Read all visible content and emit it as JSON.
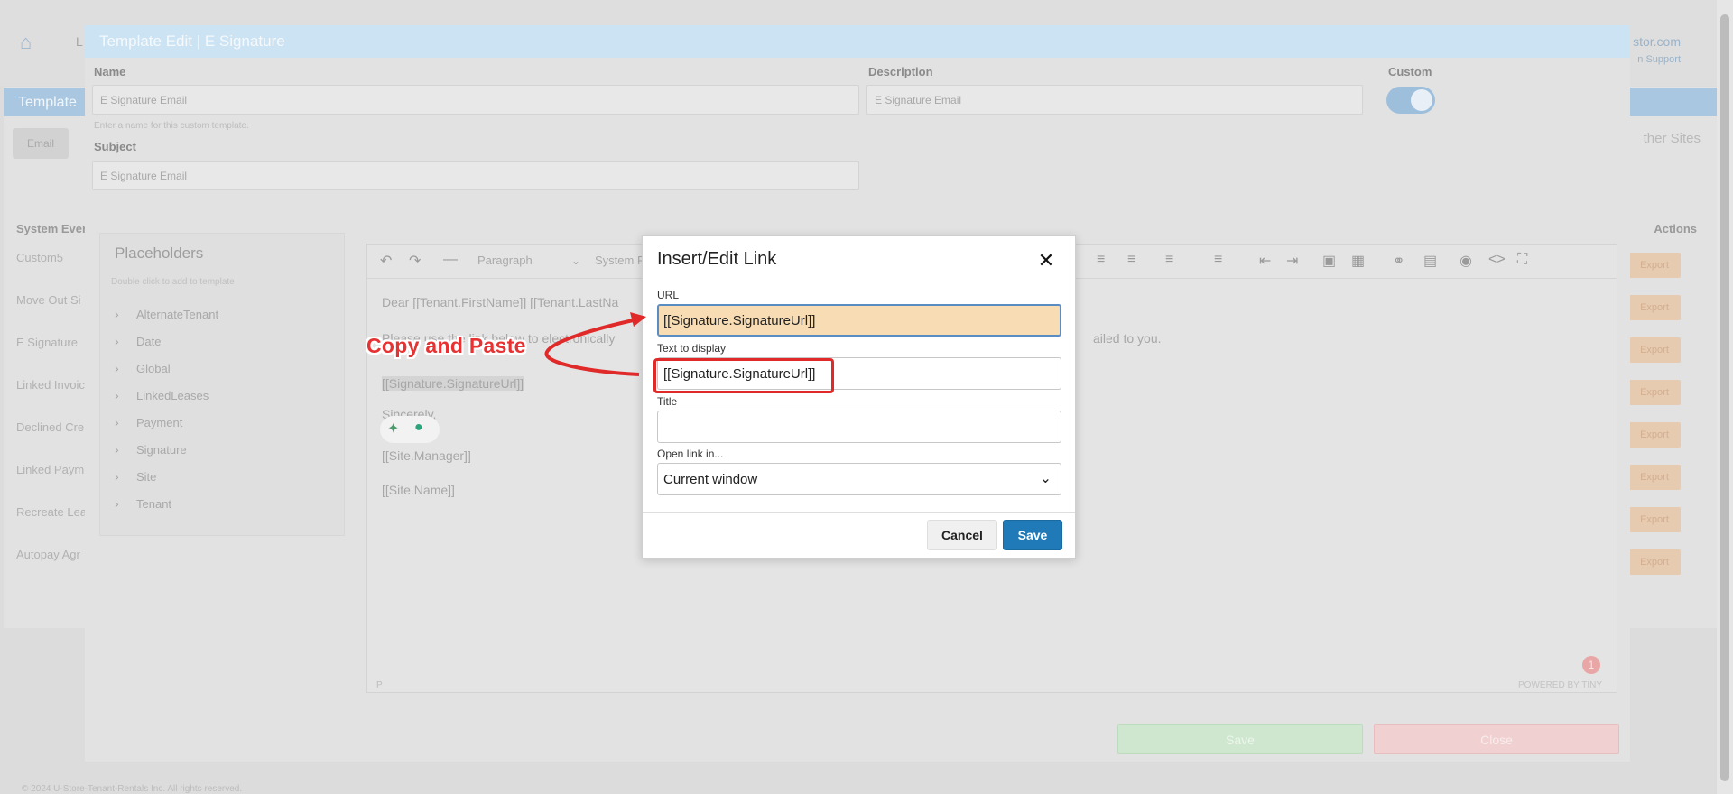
{
  "background": {
    "header_letter": "L",
    "user_line": "stor.com",
    "user_sub": "n Support",
    "page_header": "Template",
    "tab": "Email",
    "other_sites": "ther Sites",
    "system_events_label": "System Ever",
    "actions_label": "Actions",
    "rows": [
      "Custom5",
      "Move Out Si",
      "E Signature",
      "Linked Invoic",
      "Declined Cre",
      "Linked Paym",
      "Recreate Lea",
      "Autopay Agr"
    ],
    "export_label": "Export"
  },
  "template_modal": {
    "title": "Template Edit | E Signature",
    "name_label": "Name",
    "name_value": "E Signature Email",
    "name_hint": "Enter a name for this custom template.",
    "description_label": "Description",
    "description_value": "E Signature Email",
    "custom_label": "Custom",
    "subject_label": "Subject",
    "subject_value": "E Signature Email",
    "save_label": "Save",
    "close_label": "Close"
  },
  "placeholders": {
    "title": "Placeholders",
    "subtitle": "Double click to add to template",
    "items": [
      "AlternateTenant",
      "Date",
      "Global",
      "LinkedLeases",
      "Payment",
      "Signature",
      "Site",
      "Tenant"
    ]
  },
  "editor": {
    "toolbar": {
      "block_format": "Paragraph",
      "font": "System F"
    },
    "lines": {
      "greeting": "Dear [[Tenant.FirstName]] [[Tenant.LastNa",
      "body_left": "Please use the link below to electronically",
      "body_right": "ailed to you.",
      "link": "[[Signature.SignatureUrl]]",
      "sincerely": "Sincerely,",
      "manager": "[[Site.Manager]]",
      "site_name": "[[Site.Name]]"
    },
    "status_path": "P",
    "powered_by": "POWERED BY TINY",
    "badge_count": "1"
  },
  "link_dialog": {
    "title": "Insert/Edit Link",
    "url_label": "URL",
    "url_value": "[[Signature.SignatureUrl]]",
    "text_label": "Text to display",
    "text_value": "[[Signature.SignatureUrl]]",
    "title_label": "Title",
    "title_value": "",
    "open_in_label": "Open link in...",
    "open_in_value": "Current window",
    "cancel_label": "Cancel",
    "save_label": "Save"
  },
  "annotation": {
    "text": "Copy and Paste",
    "color": "#e02a2a"
  },
  "footer_text": "© 2024 U-Store-Tenant-Rentals Inc. All rights reserved.",
  "colors": {
    "accent": "#207ab7",
    "url_highlight": "#f7dcb4"
  }
}
